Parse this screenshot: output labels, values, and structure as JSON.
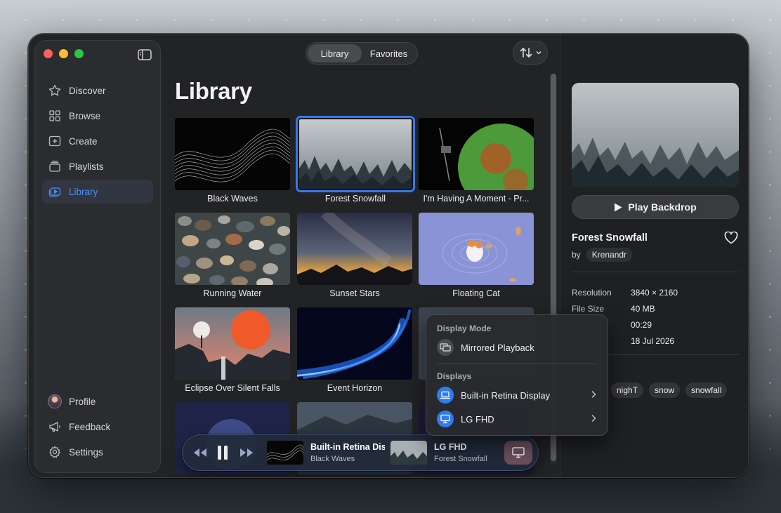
{
  "app": {
    "segments": [
      {
        "label": "Library",
        "active": true
      },
      {
        "label": "Favorites",
        "active": false
      }
    ],
    "page_title": "Library"
  },
  "sidebar": {
    "items": [
      {
        "label": "Discover",
        "icon": "star-icon"
      },
      {
        "label": "Browse",
        "icon": "grid-icon"
      },
      {
        "label": "Create",
        "icon": "plus-square-icon"
      },
      {
        "label": "Playlists",
        "icon": "stack-icon"
      },
      {
        "label": "Library",
        "icon": "play-library-icon",
        "active": true
      }
    ],
    "bottom": [
      {
        "label": "Profile",
        "icon": "avatar-icon"
      },
      {
        "label": "Feedback",
        "icon": "megaphone-icon"
      },
      {
        "label": "Settings",
        "icon": "gear-icon"
      }
    ]
  },
  "library": {
    "items": [
      {
        "title": "Black Waves"
      },
      {
        "title": "Forest Snowfall",
        "selected": true
      },
      {
        "title": "I'm Having A Moment - Pr..."
      },
      {
        "title": "Running Water"
      },
      {
        "title": "Sunset Stars"
      },
      {
        "title": "Floating Cat"
      },
      {
        "title": "Eclipse Over Silent Falls"
      },
      {
        "title": "Event Horizon"
      },
      {
        "title": ""
      },
      {
        "title": ""
      },
      {
        "title": ""
      },
      {
        "title": ""
      }
    ]
  },
  "player": {
    "displays": [
      {
        "title": "Built-in Retina Display",
        "subtitle": "Black Waves"
      },
      {
        "title": "LG FHD",
        "subtitle": "Forest Snowfall"
      }
    ]
  },
  "popover": {
    "mode_heading": "Display Mode",
    "mode_item": "Mirrored Playback",
    "displays_heading": "Displays",
    "displays": [
      {
        "label": "Built-in Retina Display",
        "icon": "laptop-icon"
      },
      {
        "label": "LG FHD",
        "icon": "monitor-icon"
      }
    ]
  },
  "detail": {
    "play_label": "Play Backdrop",
    "title": "Forest Snowfall",
    "by_label": "by",
    "author": "Krenandr",
    "meta": [
      {
        "key": "Resolution",
        "value": "3840 × 2160"
      },
      {
        "key": "File Size",
        "value": "40 MB"
      },
      {
        "key": "",
        "value": "00:29"
      },
      {
        "key": "",
        "value": "18 Jul 2026"
      }
    ],
    "tags": [
      "nighT",
      "snow",
      "snowfall"
    ]
  },
  "colors": {
    "accent": "#2f7bf0",
    "window_bg": "#222325",
    "sidebar_bg": "#2b2c2f"
  }
}
